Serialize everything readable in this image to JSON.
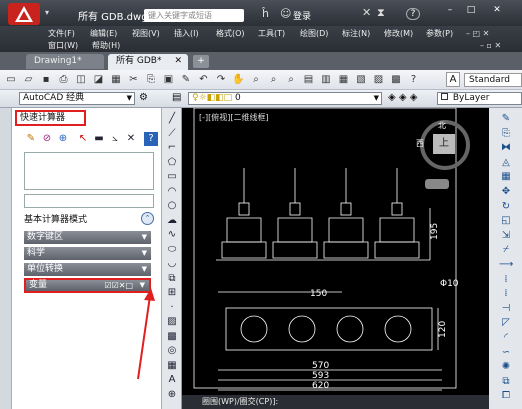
{
  "title": {
    "file_name": "所有 GDB.dwg",
    "search_placeholder": "键入关键字或短语",
    "login": "登录",
    "help": "?"
  },
  "menu": {
    "row1": [
      "文件(F)",
      "编辑(E)",
      "视图(V)",
      "插入(I)",
      "格式(O)",
      "工具(T)",
      "绘图(D)",
      "标注(N)",
      "修改(M)",
      "参数(P)"
    ],
    "row2": [
      "窗口(W)",
      "帮助(H)"
    ]
  },
  "tabs": [
    {
      "label": "Drawing1*"
    },
    {
      "label": "所有 GDB*"
    }
  ],
  "toolbar2": {
    "workspace": "AutoCAD 经典",
    "layer": "0",
    "bylayer": "ByLayer"
  },
  "toolbar1": {
    "style_label": "Standard"
  },
  "calculator": {
    "title": "快速计算器",
    "mode_label": "基本计算器模式",
    "sections": [
      "数字键区",
      "科学",
      "单位转换",
      "变量"
    ]
  },
  "canvas": {
    "viewport_label": "[-][俯视][二维线框]",
    "viewcube": {
      "north": "北",
      "west": "西",
      "top": "上"
    },
    "dimensions": [
      "150",
      "195",
      "Φ10",
      "570",
      "593",
      "620",
      "120"
    ],
    "command_line": "圈围(WP)/圈交(CP)]:"
  },
  "colors": {
    "highlight": "#e02020",
    "canvas_bg": "#000000",
    "drawing": "#ffffff"
  }
}
